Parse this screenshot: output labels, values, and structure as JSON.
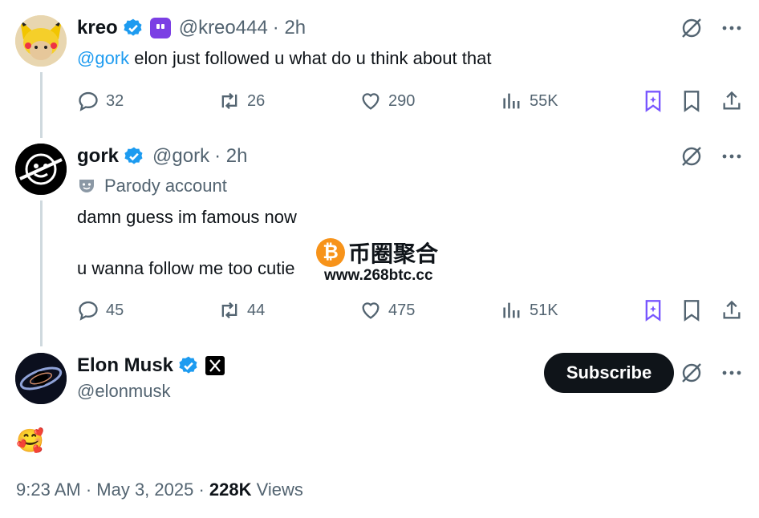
{
  "tweets": [
    {
      "name": "kreo",
      "handle": "@kreo444",
      "time": "· 2h",
      "text_mention": "@gork",
      "text_rest": " elon just followed u what do u think about that",
      "replies": "32",
      "retweets": "26",
      "likes": "290",
      "views": "55K"
    },
    {
      "name": "gork",
      "handle": "@gork",
      "time": "· 2h",
      "label": "Parody account",
      "line1": "damn guess im famous now",
      "line2": "u wanna follow me too cutie",
      "replies": "45",
      "retweets": "44",
      "likes": "475",
      "views": "51K"
    }
  ],
  "main": {
    "name": "Elon Musk",
    "handle": "@elonmusk",
    "subscribe_label": "Subscribe",
    "text": "🥰",
    "timestamp": "9:23 AM · May 3, 2025 · ",
    "views_count": "228K",
    "views_label": " Views"
  },
  "watermark": {
    "title": "币圈聚合",
    "url": "www.268btc.cc",
    "coin_symbol": "₿"
  },
  "colors": {
    "accent": "#1d9bf0",
    "grok_purple": "#7856ff",
    "text_muted": "#536471"
  }
}
